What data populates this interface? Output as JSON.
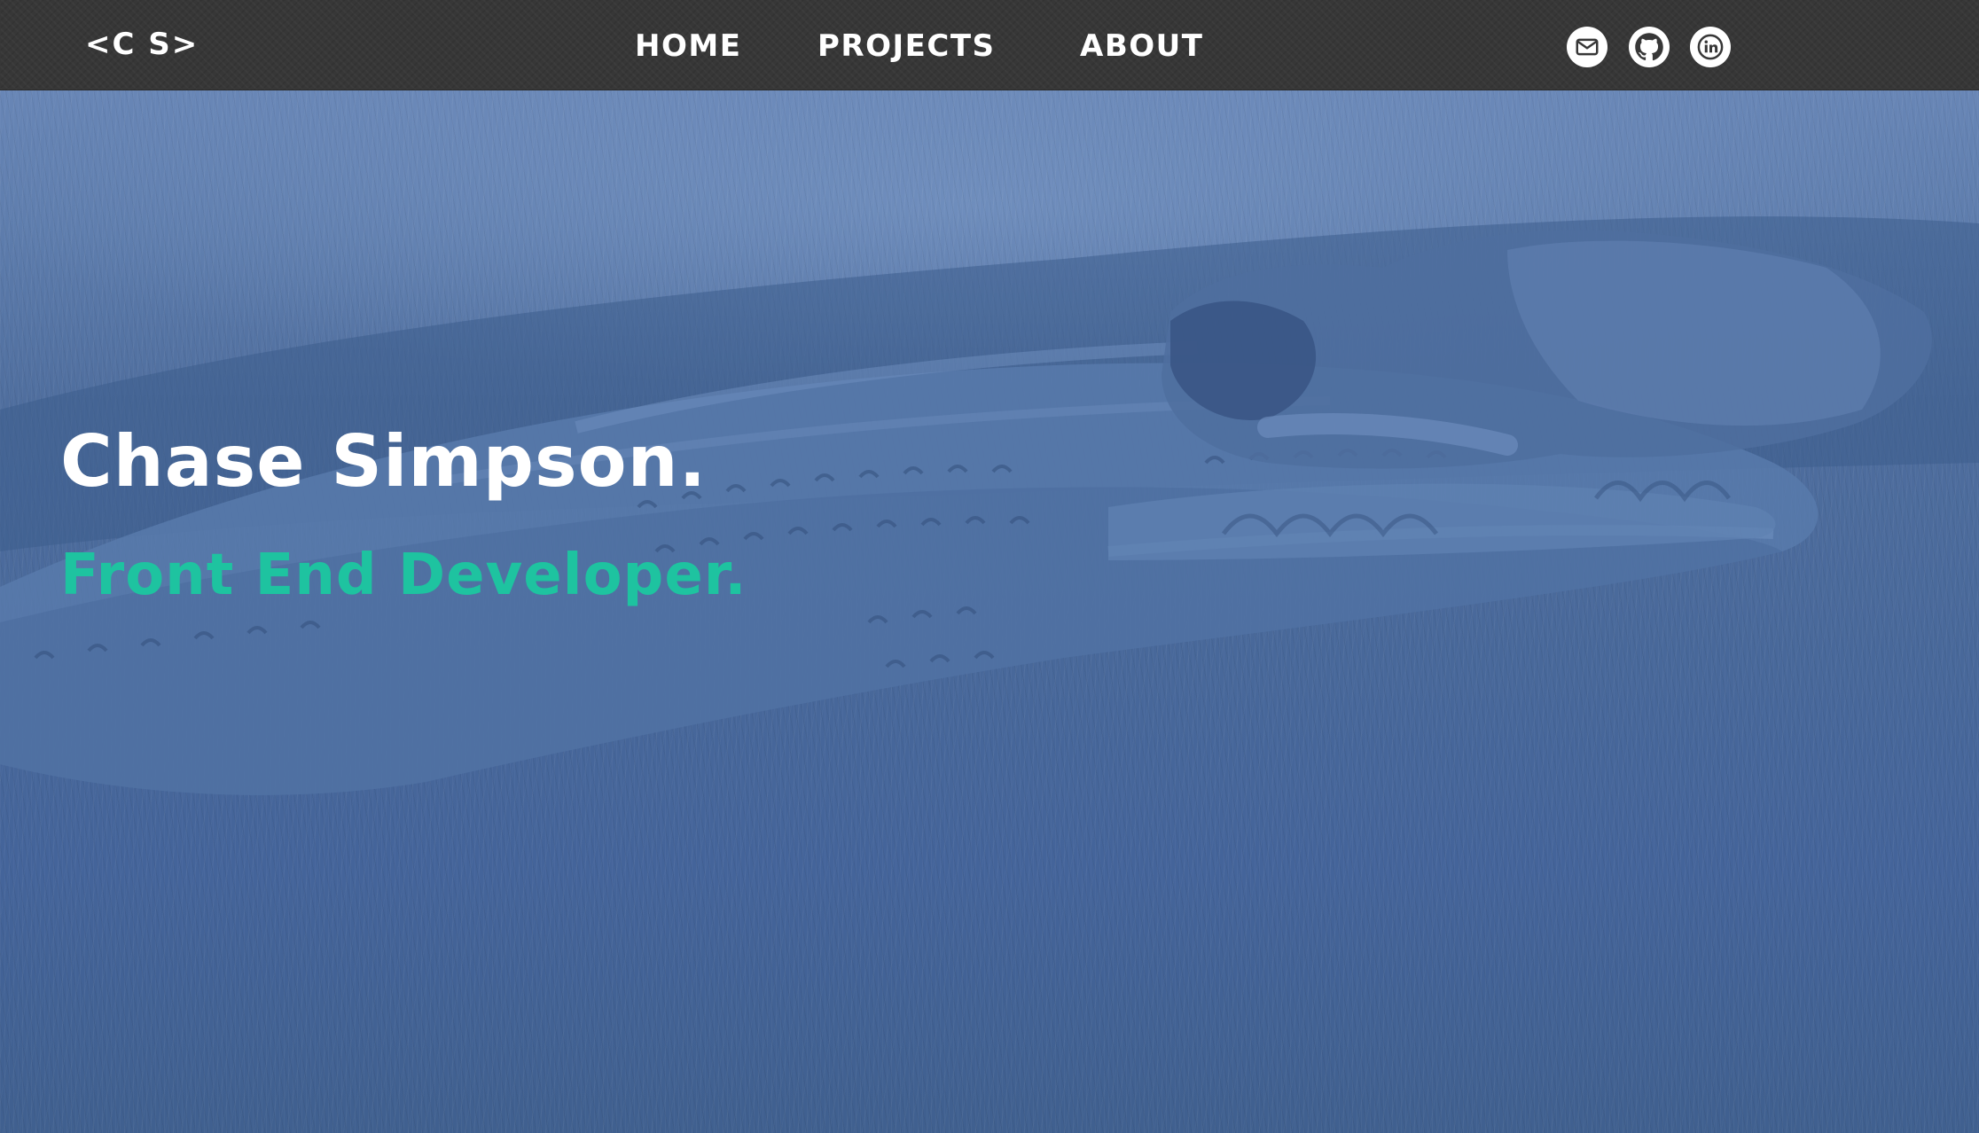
{
  "header": {
    "logo": "<C S>",
    "nav": {
      "home": "HOME",
      "projects": "PROJECTS",
      "about": "ABOUT"
    },
    "social_icons": [
      "mail-icon",
      "github-icon",
      "linkedin-icon"
    ]
  },
  "hero": {
    "title": "Chase Simpson.",
    "subtitle": "Front End Developer."
  },
  "colors": {
    "navbar_background": "#373737",
    "hero_overlay": "#4a6a9c",
    "accent": "#1ec3a0",
    "text": "#ffffff"
  }
}
